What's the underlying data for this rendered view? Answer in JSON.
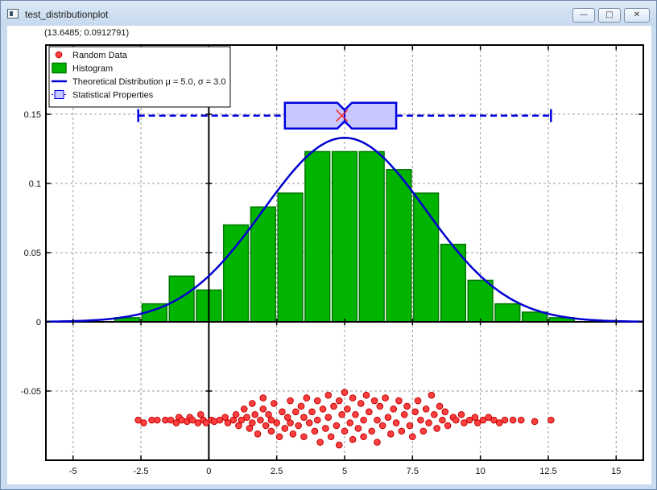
{
  "window": {
    "title": "test_distributionplot",
    "min_glyph": "—",
    "max_glyph": "□",
    "close_glyph": "✕"
  },
  "status": {
    "coordinates": "(13.6485; 0.0912791)"
  },
  "chart_data": {
    "type": "bar",
    "xlim": [
      -6,
      16
    ],
    "ylim": [
      -0.1,
      0.2
    ],
    "xticks": [
      -5,
      -2.5,
      0,
      2.5,
      5,
      7.5,
      10,
      12.5,
      15
    ],
    "xtick_labels": [
      "-5",
      "-2.5",
      "0",
      "2.5",
      "5",
      "7.5",
      "10",
      "12.5",
      "15"
    ],
    "yticks": [
      -0.05,
      0,
      0.05,
      0.1,
      0.15
    ],
    "ytick_labels": [
      "-0.05",
      "0",
      "0.05",
      "0.1",
      "0.15"
    ],
    "grid": true,
    "legend_position": "top-left",
    "legend": [
      {
        "name": "Random Data",
        "symbol": "circle"
      },
      {
        "name": "Histogram",
        "symbol": "bar"
      },
      {
        "name": "Theoretical Distribution μ = 5.0, σ = 3.0",
        "symbol": "line"
      },
      {
        "name": "Statistical Properties",
        "symbol": "box"
      }
    ],
    "histogram": {
      "bin_width": 1,
      "bin_centers": [
        -3,
        -2,
        -1,
        0,
        1,
        2,
        3,
        4,
        5,
        6,
        7,
        8,
        9,
        10,
        11,
        12,
        13
      ],
      "values": [
        0.003,
        0.013,
        0.033,
        0.023,
        0.07,
        0.083,
        0.093,
        0.123,
        0.123,
        0.123,
        0.11,
        0.093,
        0.056,
        0.03,
        0.013,
        0.007,
        0.003
      ],
      "color": "#00b400",
      "edge_color": "#007800"
    },
    "distribution": {
      "mu": 5.0,
      "sigma": 3.0,
      "x_range": [
        -6,
        16
      ],
      "color": "#0000d0"
    },
    "boxplot": {
      "y": 0.149,
      "min": -2.6,
      "q1": 2.8,
      "median": 5.0,
      "q3": 6.9,
      "max": 12.6,
      "mean": 4.9,
      "color": "#0000e0",
      "fill": "#c8c8ff"
    },
    "random_data": {
      "color": "#ff4040",
      "y_center": -0.072,
      "points": [
        [
          -2.6,
          -0.071
        ],
        [
          -2.4,
          -0.073
        ],
        [
          -2.1,
          -0.071
        ],
        [
          -1.9,
          -0.071
        ],
        [
          -1.6,
          -0.071
        ],
        [
          -1.4,
          -0.071
        ],
        [
          -1.2,
          -0.073
        ],
        [
          -1.1,
          -0.069
        ],
        [
          -1.0,
          -0.071
        ],
        [
          -0.8,
          -0.072
        ],
        [
          -0.7,
          -0.069
        ],
        [
          -0.6,
          -0.071
        ],
        [
          -0.4,
          -0.073
        ],
        [
          -0.3,
          -0.067
        ],
        [
          -0.2,
          -0.071
        ],
        [
          -0.1,
          -0.073
        ],
        [
          0.1,
          -0.071
        ],
        [
          0.2,
          -0.072
        ],
        [
          0.4,
          -0.071
        ],
        [
          0.6,
          -0.069
        ],
        [
          0.7,
          -0.073
        ],
        [
          0.9,
          -0.071
        ],
        [
          1.0,
          -0.067
        ],
        [
          1.1,
          -0.075
        ],
        [
          1.2,
          -0.071
        ],
        [
          1.3,
          -0.063
        ],
        [
          1.4,
          -0.069
        ],
        [
          1.5,
          -0.077
        ],
        [
          1.6,
          -0.059
        ],
        [
          1.6,
          -0.073
        ],
        [
          1.7,
          -0.067
        ],
        [
          1.8,
          -0.081
        ],
        [
          1.9,
          -0.071
        ],
        [
          2.0,
          -0.055
        ],
        [
          2.0,
          -0.063
        ],
        [
          2.1,
          -0.075
        ],
        [
          2.2,
          -0.067
        ],
        [
          2.3,
          -0.079
        ],
        [
          2.3,
          -0.071
        ],
        [
          2.4,
          -0.059
        ],
        [
          2.5,
          -0.073
        ],
        [
          2.6,
          -0.083
        ],
        [
          2.7,
          -0.065
        ],
        [
          2.8,
          -0.077
        ],
        [
          2.9,
          -0.069
        ],
        [
          3.0,
          -0.057
        ],
        [
          3.0,
          -0.073
        ],
        [
          3.1,
          -0.081
        ],
        [
          3.2,
          -0.065
        ],
        [
          3.3,
          -0.075
        ],
        [
          3.4,
          -0.061
        ],
        [
          3.5,
          -0.069
        ],
        [
          3.5,
          -0.083
        ],
        [
          3.6,
          -0.055
        ],
        [
          3.7,
          -0.073
        ],
        [
          3.8,
          -0.065
        ],
        [
          3.9,
          -0.079
        ],
        [
          4.0,
          -0.057
        ],
        [
          4.0,
          -0.071
        ],
        [
          4.1,
          -0.087
        ],
        [
          4.2,
          -0.063
        ],
        [
          4.3,
          -0.077
        ],
        [
          4.4,
          -0.053
        ],
        [
          4.4,
          -0.069
        ],
        [
          4.5,
          -0.083
        ],
        [
          4.6,
          -0.061
        ],
        [
          4.7,
          -0.075
        ],
        [
          4.8,
          -0.057
        ],
        [
          4.8,
          -0.089
        ],
        [
          4.9,
          -0.067
        ],
        [
          5.0,
          -0.051
        ],
        [
          5.0,
          -0.079
        ],
        [
          5.1,
          -0.063
        ],
        [
          5.2,
          -0.073
        ],
        [
          5.3,
          -0.055
        ],
        [
          5.3,
          -0.085
        ],
        [
          5.4,
          -0.067
        ],
        [
          5.5,
          -0.077
        ],
        [
          5.6,
          -0.059
        ],
        [
          5.7,
          -0.071
        ],
        [
          5.7,
          -0.083
        ],
        [
          5.8,
          -0.053
        ],
        [
          5.9,
          -0.065
        ],
        [
          6.0,
          -0.079
        ],
        [
          6.1,
          -0.057
        ],
        [
          6.2,
          -0.071
        ],
        [
          6.2,
          -0.087
        ],
        [
          6.3,
          -0.061
        ],
        [
          6.4,
          -0.075
        ],
        [
          6.5,
          -0.055
        ],
        [
          6.6,
          -0.069
        ],
        [
          6.7,
          -0.081
        ],
        [
          6.8,
          -0.063
        ],
        [
          6.9,
          -0.073
        ],
        [
          7.0,
          -0.057
        ],
        [
          7.1,
          -0.079
        ],
        [
          7.2,
          -0.067
        ],
        [
          7.3,
          -0.061
        ],
        [
          7.4,
          -0.075
        ],
        [
          7.5,
          -0.083
        ],
        [
          7.6,
          -0.065
        ],
        [
          7.7,
          -0.057
        ],
        [
          7.8,
          -0.071
        ],
        [
          7.9,
          -0.079
        ],
        [
          8.0,
          -0.063
        ],
        [
          8.1,
          -0.073
        ],
        [
          8.2,
          -0.053
        ],
        [
          8.3,
          -0.067
        ],
        [
          8.4,
          -0.077
        ],
        [
          8.5,
          -0.061
        ],
        [
          8.6,
          -0.071
        ],
        [
          8.7,
          -0.065
        ],
        [
          8.8,
          -0.075
        ],
        [
          9.0,
          -0.069
        ],
        [
          9.1,
          -0.071
        ],
        [
          9.3,
          -0.067
        ],
        [
          9.4,
          -0.073
        ],
        [
          9.6,
          -0.071
        ],
        [
          9.8,
          -0.069
        ],
        [
          9.9,
          -0.073
        ],
        [
          10.1,
          -0.071
        ],
        [
          10.3,
          -0.069
        ],
        [
          10.5,
          -0.071
        ],
        [
          10.7,
          -0.073
        ],
        [
          10.9,
          -0.071
        ],
        [
          11.2,
          -0.071
        ],
        [
          11.5,
          -0.071
        ],
        [
          12.0,
          -0.072
        ],
        [
          12.6,
          -0.071
        ]
      ]
    }
  }
}
